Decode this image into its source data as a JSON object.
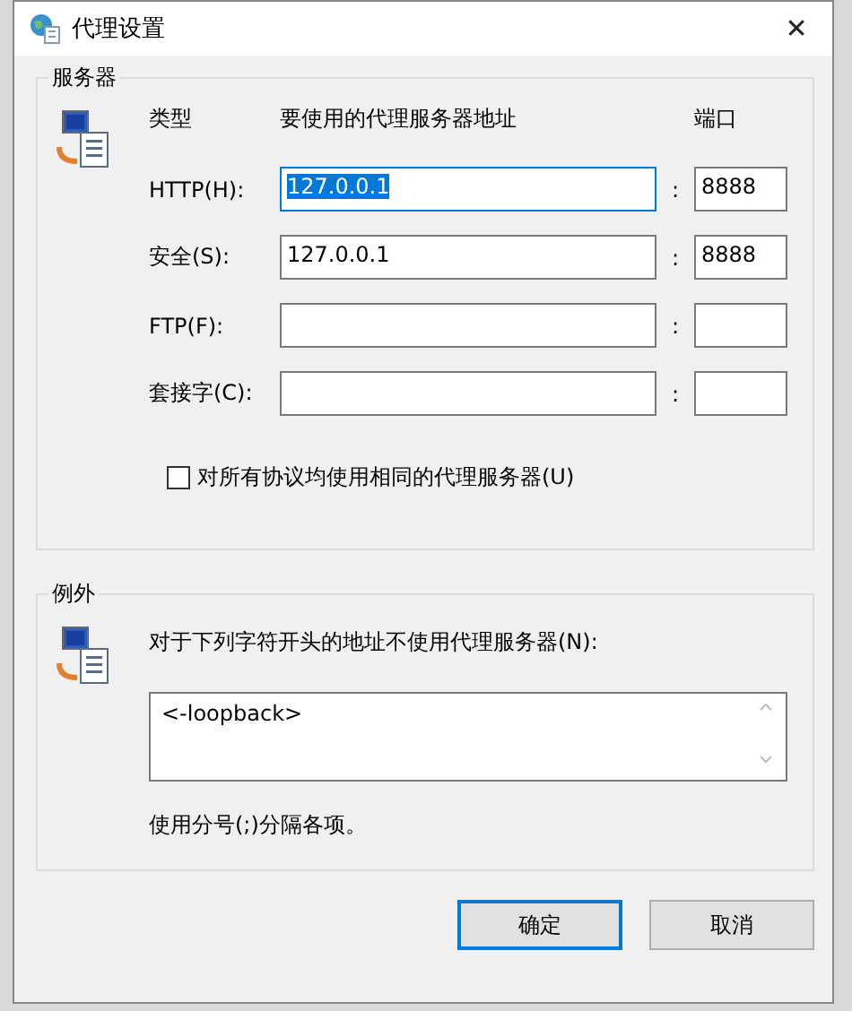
{
  "window": {
    "title": "代理设置",
    "close": "✕"
  },
  "servers": {
    "legend": "服务器",
    "headers": {
      "type": "类型",
      "address": "要使用的代理服务器地址",
      "port": "端口"
    },
    "rows": [
      {
        "label": "HTTP(H):",
        "address": "127.0.0.1",
        "separator": ":",
        "port": "8888",
        "selected": true
      },
      {
        "label": "安全(S):",
        "address": "127.0.0.1",
        "separator": ":",
        "port": "8888",
        "selected": false
      },
      {
        "label": "FTP(F):",
        "separator": ":",
        "selected": false
      },
      {
        "label": "套接字(C):",
        "separator": ":",
        "selected": false
      }
    ],
    "same_for_all": {
      "label": "对所有协议均使用相同的代理服务器(U)",
      "checked": false
    }
  },
  "exceptions": {
    "legend": "例外",
    "description": "对于下列字符开头的地址不使用代理服务器(N):",
    "value": "<-loopback>",
    "note": "使用分号(;)分隔各项。"
  },
  "buttons": [
    {
      "label": "确定",
      "selected": true
    },
    {
      "label": "取消",
      "selected": false
    }
  ]
}
